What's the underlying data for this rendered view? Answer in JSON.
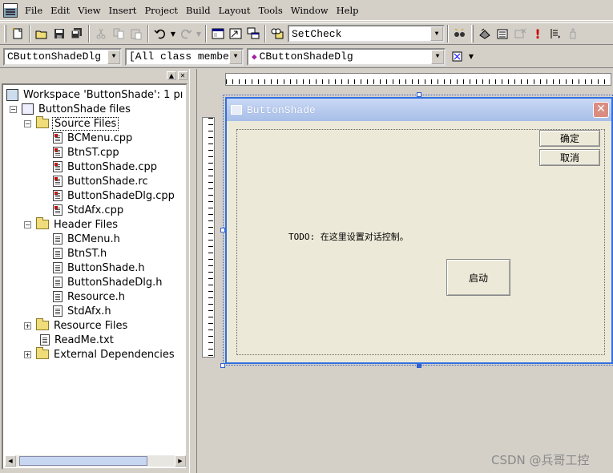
{
  "menu": [
    "File",
    "Edit",
    "View",
    "Insert",
    "Project",
    "Build",
    "Layout",
    "Tools",
    "Window",
    "Help"
  ],
  "toolbar": {
    "find_value": "SetCheck",
    "icons": [
      "new-file-icon",
      "open-icon",
      "save-icon",
      "save-all-icon",
      "cut-icon",
      "copy-icon",
      "paste-icon",
      "undo-icon",
      "redo-icon",
      "workspace-icon",
      "output-icon",
      "windows-icon",
      "find-in-files-icon",
      "find-icon",
      "compile-icon",
      "build-icon",
      "stop-build-icon",
      "execute-icon",
      "insert-breakpoint-icon",
      "go-icon"
    ]
  },
  "wizardbar": {
    "class_combo": "CButtonShadeDlg",
    "filter_combo": "[All class members]",
    "member_combo": "CButtonShadeDlg"
  },
  "workspace": {
    "tree": [
      {
        "label": "Workspace 'ButtonShade': 1 pı",
        "icon": "workspace-icon",
        "level": 0
      },
      {
        "label": "ButtonShade files",
        "icon": "project-icon",
        "level": 0,
        "expand": "−"
      },
      {
        "label": "Source Files",
        "icon": "folder-icon",
        "level": 1,
        "expand": "−",
        "selected": true
      },
      {
        "label": "BCMenu.cpp",
        "icon": "cpp-file-icon",
        "level": 2
      },
      {
        "label": "BtnST.cpp",
        "icon": "cpp-file-icon",
        "level": 2
      },
      {
        "label": "ButtonShade.cpp",
        "icon": "cpp-file-icon",
        "level": 2
      },
      {
        "label": "ButtonShade.rc",
        "icon": "cpp-file-icon",
        "level": 2
      },
      {
        "label": "ButtonShadeDlg.cpp",
        "icon": "cpp-file-icon",
        "level": 2
      },
      {
        "label": "StdAfx.cpp",
        "icon": "cpp-file-icon",
        "level": 2
      },
      {
        "label": "Header Files",
        "icon": "folder-icon",
        "level": 1,
        "expand": "−"
      },
      {
        "label": "BCMenu.h",
        "icon": "header-file-icon",
        "level": 2
      },
      {
        "label": "BtnST.h",
        "icon": "header-file-icon",
        "level": 2
      },
      {
        "label": "ButtonShade.h",
        "icon": "header-file-icon",
        "level": 2
      },
      {
        "label": "ButtonShadeDlg.h",
        "icon": "header-file-icon",
        "level": 2
      },
      {
        "label": "Resource.h",
        "icon": "header-file-icon",
        "level": 2
      },
      {
        "label": "StdAfx.h",
        "icon": "header-file-icon",
        "level": 2
      },
      {
        "label": "Resource Files",
        "icon": "folder-icon",
        "level": 1,
        "expand": "+"
      },
      {
        "label": "ReadMe.txt",
        "icon": "text-file-icon",
        "level": 1
      },
      {
        "label": "External Dependencies",
        "icon": "folder-icon",
        "level": 1,
        "expand": "+"
      }
    ]
  },
  "dialog": {
    "title": "ButtonShade",
    "ok_label": "确定",
    "cancel_label": "取消",
    "todo_text": "TODO: 在这里设置对话控制。",
    "start_label": "启动"
  },
  "watermark": "CSDN @兵哥工控"
}
